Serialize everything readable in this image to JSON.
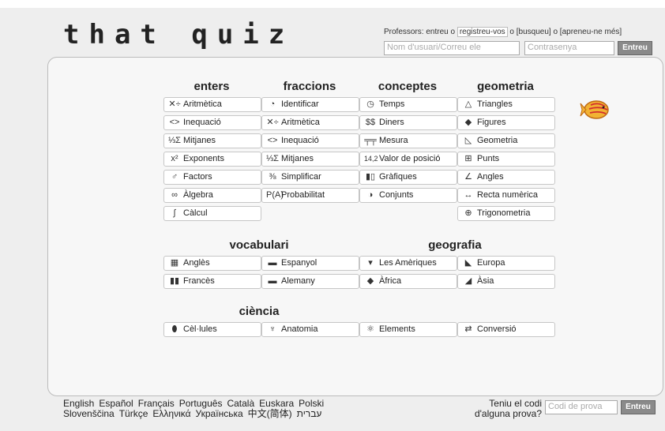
{
  "top_fragment": "(                                                                          )",
  "logo": "that quiz",
  "header": {
    "professors_prefix": "Professors: entreu o",
    "register_link": "registreu-vos",
    "professors_suffix": "o [busqueu] o [apreneu-ne més]",
    "user_placeholder": "Nom d'usuari/Correu ele",
    "password_placeholder": "Contrasenya",
    "login_button": "Entreu"
  },
  "sections": {
    "enters": "enters",
    "fraccions": "fraccions",
    "conceptes": "conceptes",
    "geometria": "geometria",
    "vocabulari": "vocabulari",
    "geografia": "geografia",
    "ciencia": "ciència"
  },
  "enters": [
    {
      "icon": "✕÷",
      "label": "Aritmètica"
    },
    {
      "icon": "<>",
      "label": "Inequació"
    },
    {
      "icon": "⅓Σ",
      "label": "Mitjanes"
    },
    {
      "icon": "x²",
      "label": "Exponents"
    },
    {
      "icon": "♂",
      "label": "Factors"
    },
    {
      "icon": "∞",
      "label": "Àlgebra"
    },
    {
      "icon": "∫",
      "label": "Càlcul"
    }
  ],
  "fraccions": [
    {
      "icon": "◔",
      "label": "Identificar"
    },
    {
      "icon": "✕÷",
      "label": "Aritmètica"
    },
    {
      "icon": "<>",
      "label": "Inequació"
    },
    {
      "icon": "⅓Σ",
      "label": "Mitjanes"
    },
    {
      "icon": "⅜",
      "label": "Simplificar"
    },
    {
      "icon": "P(A)",
      "label": "Probabilitat"
    }
  ],
  "conceptes": [
    {
      "icon": "◷",
      "label": "Temps"
    },
    {
      "icon": "$$",
      "label": "Diners"
    },
    {
      "icon": "╤╤",
      "label": "Mesura"
    },
    {
      "icon": "14,2",
      "label": "Valor de posició"
    },
    {
      "icon": "▮▯",
      "label": "Gràfiques"
    },
    {
      "icon": "◑",
      "label": "Conjunts"
    }
  ],
  "geometria": [
    {
      "icon": "△",
      "label": "Triangles"
    },
    {
      "icon": "◆",
      "label": "Figures"
    },
    {
      "icon": "◺",
      "label": "Geometria"
    },
    {
      "icon": "⊞",
      "label": "Punts"
    },
    {
      "icon": "∠",
      "label": "Angles"
    },
    {
      "icon": "↔",
      "label": "Recta numèrica"
    },
    {
      "icon": "⊕",
      "label": "Trigonometria"
    }
  ],
  "vocabulari": [
    {
      "icon": "▦",
      "label": "Anglès"
    },
    {
      "icon": "▬",
      "label": "Espanyol"
    },
    {
      "icon": "▮▮",
      "label": "Francès"
    },
    {
      "icon": "▬",
      "label": "Alemany"
    }
  ],
  "geografia": [
    {
      "icon": "▾",
      "label": "Les Amèriques"
    },
    {
      "icon": "◣",
      "label": "Europa"
    },
    {
      "icon": "◆",
      "label": "Àfrica"
    },
    {
      "icon": "◢",
      "label": "Àsia"
    }
  ],
  "ciencia": [
    {
      "icon": "⬮",
      "label": "Cèl·lules"
    },
    {
      "icon": "♆",
      "label": "Anatomia"
    },
    {
      "icon": "⚛",
      "label": "Elements"
    },
    {
      "icon": "⇄",
      "label": "Conversió"
    }
  ],
  "footer": {
    "languages_row1": [
      "English",
      "Español",
      "Français",
      "Português",
      "Català",
      "Euskara",
      "Polski"
    ],
    "languages_row2": [
      "Slovenščina",
      "Türkçe",
      "Ελληνικά",
      "Українська",
      "中文(简体)",
      "עברית"
    ],
    "code_question": "Teniu el codi d'alguna prova?",
    "code_placeholder": "Codi de prova",
    "code_button": "Entreu"
  }
}
